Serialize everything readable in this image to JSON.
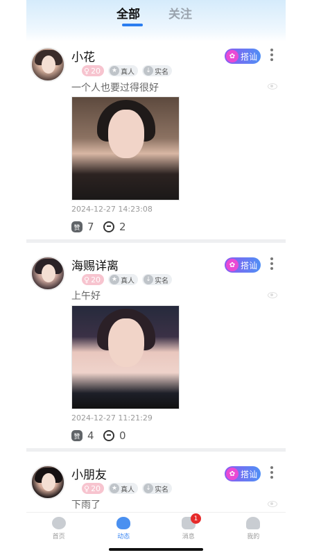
{
  "header": {
    "tabs": [
      {
        "label": "全部",
        "active": true
      },
      {
        "label": "关注",
        "active": false
      }
    ]
  },
  "posts": [
    {
      "name": "小花",
      "age": "20",
      "tag_real": "真人",
      "tag_verified": "实名",
      "chat_label": "搭讪",
      "text": "一个人也要过得很好",
      "time": "2024-12-27 14:23:08",
      "likes": "7",
      "comments": "2",
      "like_label": "赞"
    },
    {
      "name": "海赐详离",
      "age": "20",
      "tag_real": "真人",
      "tag_verified": "实名",
      "chat_label": "搭讪",
      "text": "上午好",
      "time": "2024-12-27 11:21:29",
      "likes": "4",
      "comments": "0",
      "like_label": "赞"
    },
    {
      "name": "小朋友",
      "age": "20",
      "tag_real": "真人",
      "tag_verified": "实名",
      "chat_label": "搭讪",
      "text": "下雨了"
    }
  ],
  "tabbar": {
    "items": [
      {
        "label": "首页",
        "icon": "planet-icon",
        "active": false
      },
      {
        "label": "动态",
        "icon": "heart-cloud-icon",
        "active": true
      },
      {
        "label": "消息",
        "icon": "message-icon",
        "active": false,
        "badge": "1"
      },
      {
        "label": "我的",
        "icon": "user-icon",
        "active": false
      }
    ]
  },
  "colors": {
    "accent": "#2a7df0",
    "age_badge": "#f7c4cf",
    "notification": "#e62a2a"
  }
}
